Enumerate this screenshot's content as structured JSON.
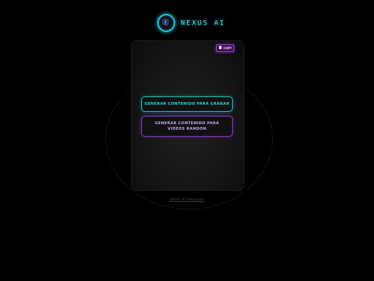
{
  "header": {
    "brand": "NEXUS AI",
    "logo_icon": "neural-brain-icon"
  },
  "card": {
    "copy_button": {
      "label": "COPY",
      "icon": "clipboard-icon"
    },
    "actions": [
      {
        "label": "GENERAR CONTENIDO PARA GRABAR"
      },
      {
        "label": "GENERAR CONTENIDO PARA VIDEOS RANDON"
      }
    ]
  },
  "footer": {
    "back_link": "Volver al Dashboard"
  },
  "colors": {
    "background": "#000000",
    "accent_cyan": "#1ec8d8",
    "accent_purple": "#8a3ad6"
  }
}
